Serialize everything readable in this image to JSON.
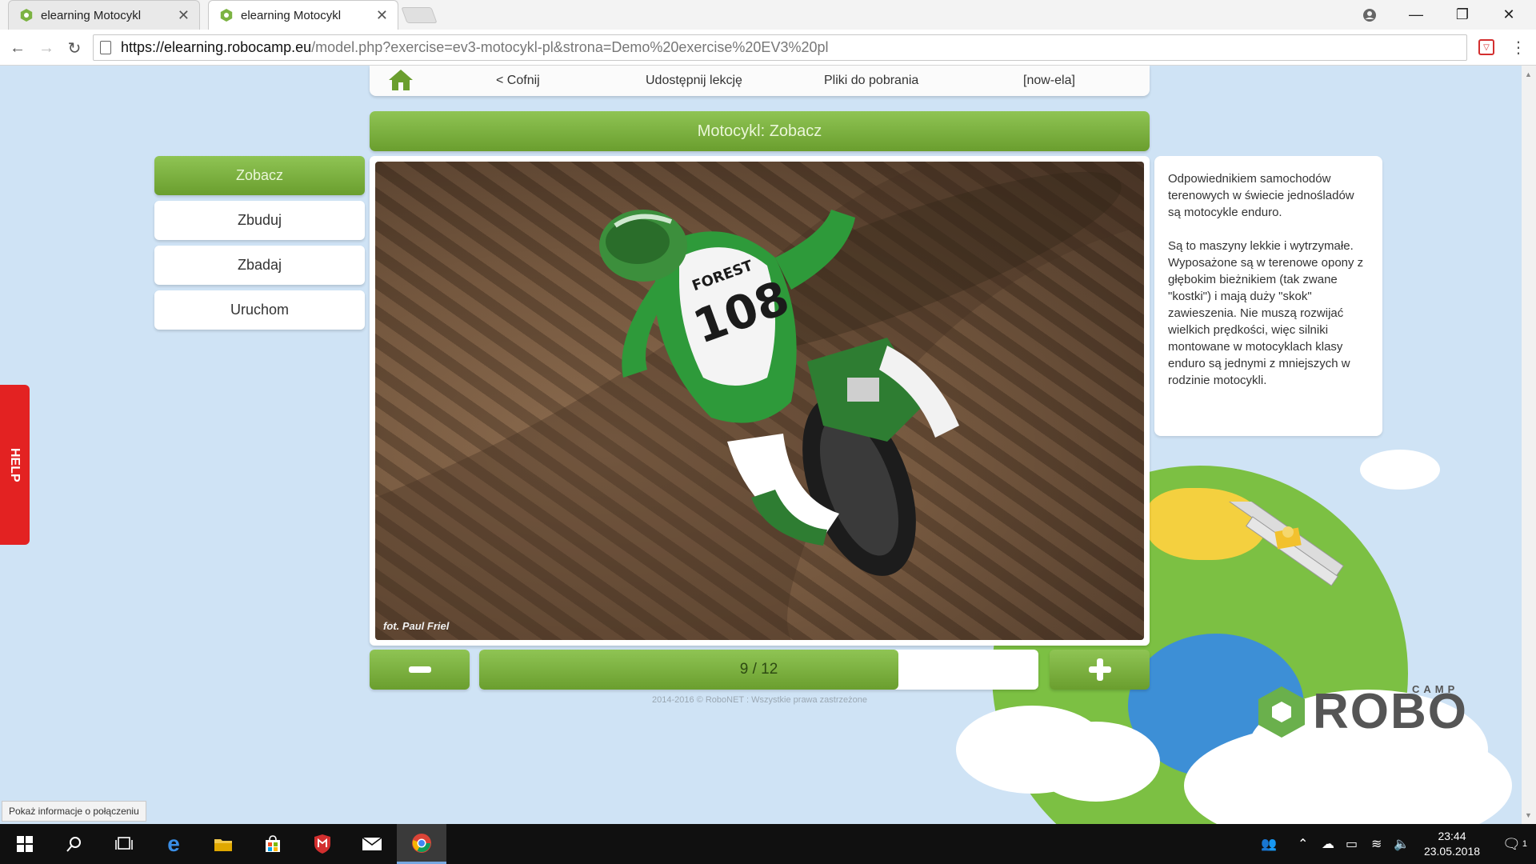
{
  "browser": {
    "tabs": [
      {
        "title": "elearning Motocykl",
        "active": false
      },
      {
        "title": "elearning Motocykl",
        "active": true
      }
    ],
    "url_host": "https://elearning.robocamp.eu",
    "url_path": "/model.php?exercise=ev3-motocykl-pl&strona=Demo%20exercise%20EV3%20pl"
  },
  "nav": {
    "back": "< Cofnij",
    "share": "Udostępnij lekcję",
    "downloads": "Pliki do pobrania",
    "user": "[now-ela]"
  },
  "title": "Motocykl: Zobacz",
  "sidebar": {
    "items": [
      {
        "label": "Zobacz",
        "active": true
      },
      {
        "label": "Zbuduj",
        "active": false
      },
      {
        "label": "Zbadaj",
        "active": false
      },
      {
        "label": "Uruchom",
        "active": false
      }
    ]
  },
  "photo": {
    "credit": "fot. Paul Friel",
    "rider_number": "108",
    "rider_name": "FOREST"
  },
  "description": {
    "p1": "Odpowiednikiem samochodów terenowych w świecie jednośladów są motocykle enduro.",
    "p2": "Są to maszyny lekkie i wytrzymałe. Wyposażone są w terenowe opony z głębokim bieżnikiem (tak zwane \"kostki\") i mają duży \"skok\" zawieszenia. Nie muszą rozwijać wielkich prędkości, więc silniki montowane w motocyklach klasy enduro są jednymi z mniejszych w rodzinie motocykli."
  },
  "pager": {
    "label": "9 / 12",
    "current": 9,
    "total": 12,
    "progress_fraction": 0.75
  },
  "footer": "2014-2016 © RoboNET : Wszystkie prawa zastrzeżone",
  "help_label": "HELP",
  "logo": {
    "main": "ROBO",
    "sub": "CAMP"
  },
  "status_bubble": "Pokaż informacje o połączeniu",
  "taskbar": {
    "time": "23:44",
    "date": "23.05.2018",
    "notification_count": "1"
  },
  "colors": {
    "accent_green": "#7cb342",
    "help_red": "#e32222",
    "page_bg": "#cfe3f5"
  }
}
